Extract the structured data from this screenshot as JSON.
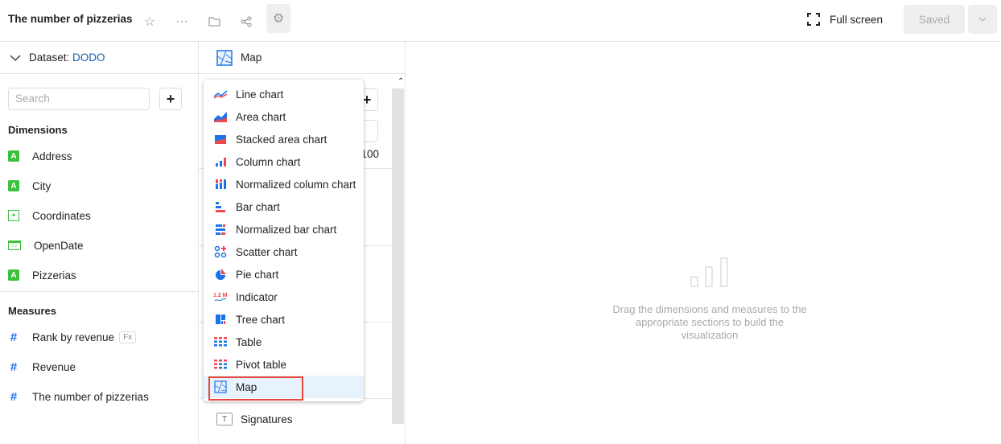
{
  "header": {
    "title": "The number of pizzerias",
    "full_screen": "Full screen",
    "saved": "Saved"
  },
  "dataset": {
    "label": "Dataset:",
    "name": "DODO"
  },
  "search": {
    "placeholder": "Search"
  },
  "dimensions": {
    "title": "Dimensions",
    "items": [
      {
        "label": "Address",
        "icon": "string-icon"
      },
      {
        "label": "City",
        "icon": "string-icon"
      },
      {
        "label": "Coordinates",
        "icon": "geo-icon"
      },
      {
        "label": "OpenDate",
        "icon": "date-icon"
      },
      {
        "label": "Pizzerias",
        "icon": "string-icon"
      }
    ]
  },
  "measures": {
    "title": "Measures",
    "items": [
      {
        "label": "Rank by revenue",
        "badge": "Fx"
      },
      {
        "label": "Revenue"
      },
      {
        "label": "The number of pizzerias"
      }
    ]
  },
  "visualization": {
    "selected": "Map",
    "partial_value": "100",
    "signatures": "Signatures"
  },
  "menu": {
    "items": [
      "Line chart",
      "Area chart",
      "Stacked area chart",
      "Column chart",
      "Normalized column chart",
      "Bar chart",
      "Normalized bar chart",
      "Scatter chart",
      "Pie chart",
      "Indicator",
      "Tree chart",
      "Table",
      "Pivot table",
      "Map"
    ],
    "selected": "Map",
    "indicator_icon_text": "1.2 M"
  },
  "empty_state": {
    "text": "Drag the dimensions and measures to the appropriate sections to build the visualization"
  },
  "colors": {
    "blue": "#1a73e8",
    "red": "#f0474c",
    "green": "#3bc13b",
    "selected_bg": "#e8f2fc"
  }
}
